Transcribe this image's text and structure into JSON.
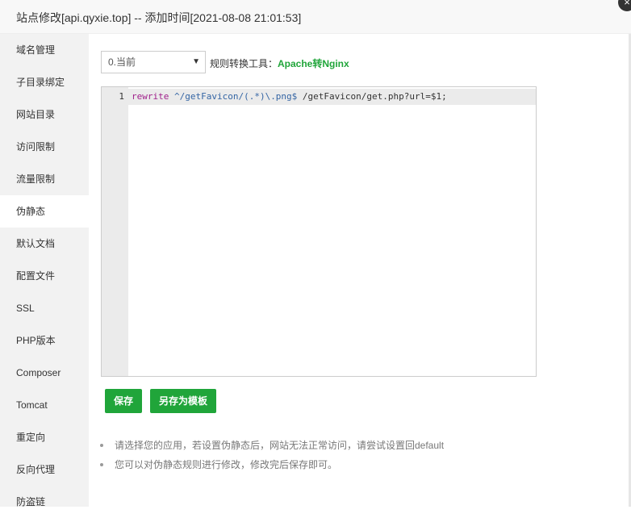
{
  "window": {
    "title": "站点修改[api.qyxie.top] -- 添加时间[2021-08-08 21:01:53]",
    "close_glyph": "×"
  },
  "sidebar": {
    "items": [
      {
        "label": "域名管理"
      },
      {
        "label": "子目录绑定"
      },
      {
        "label": "网站目录"
      },
      {
        "label": "访问限制"
      },
      {
        "label": "流量限制"
      },
      {
        "label": "伪静态"
      },
      {
        "label": "默认文档"
      },
      {
        "label": "配置文件"
      },
      {
        "label": "SSL"
      },
      {
        "label": "PHP版本"
      },
      {
        "label": "Composer"
      },
      {
        "label": "Tomcat"
      },
      {
        "label": "重定向"
      },
      {
        "label": "反向代理"
      },
      {
        "label": "防盗链"
      }
    ],
    "active_index": 5
  },
  "rewrite": {
    "select_value": "0.当前",
    "tool_label": "规则转换工具：",
    "tool_link": "Apache转Nginx",
    "editor": {
      "line_number": "1",
      "code_keyword": "rewrite",
      "code_pattern": " ^/getFavicon/(.*)\\.png$",
      "code_rest": " /getFavicon/get.php?url=$1;"
    },
    "save_label": "保存",
    "save_template_label": "另存为模板",
    "tips": [
      "请选择您的应用，若设置伪静态后，网站无法正常访问，请尝试设置回default",
      "您可以对伪静态规则进行修改，修改完后保存即可。"
    ]
  },
  "colors": {
    "accent": "#20a53a",
    "sidebar_bg": "#f2f2f2"
  }
}
